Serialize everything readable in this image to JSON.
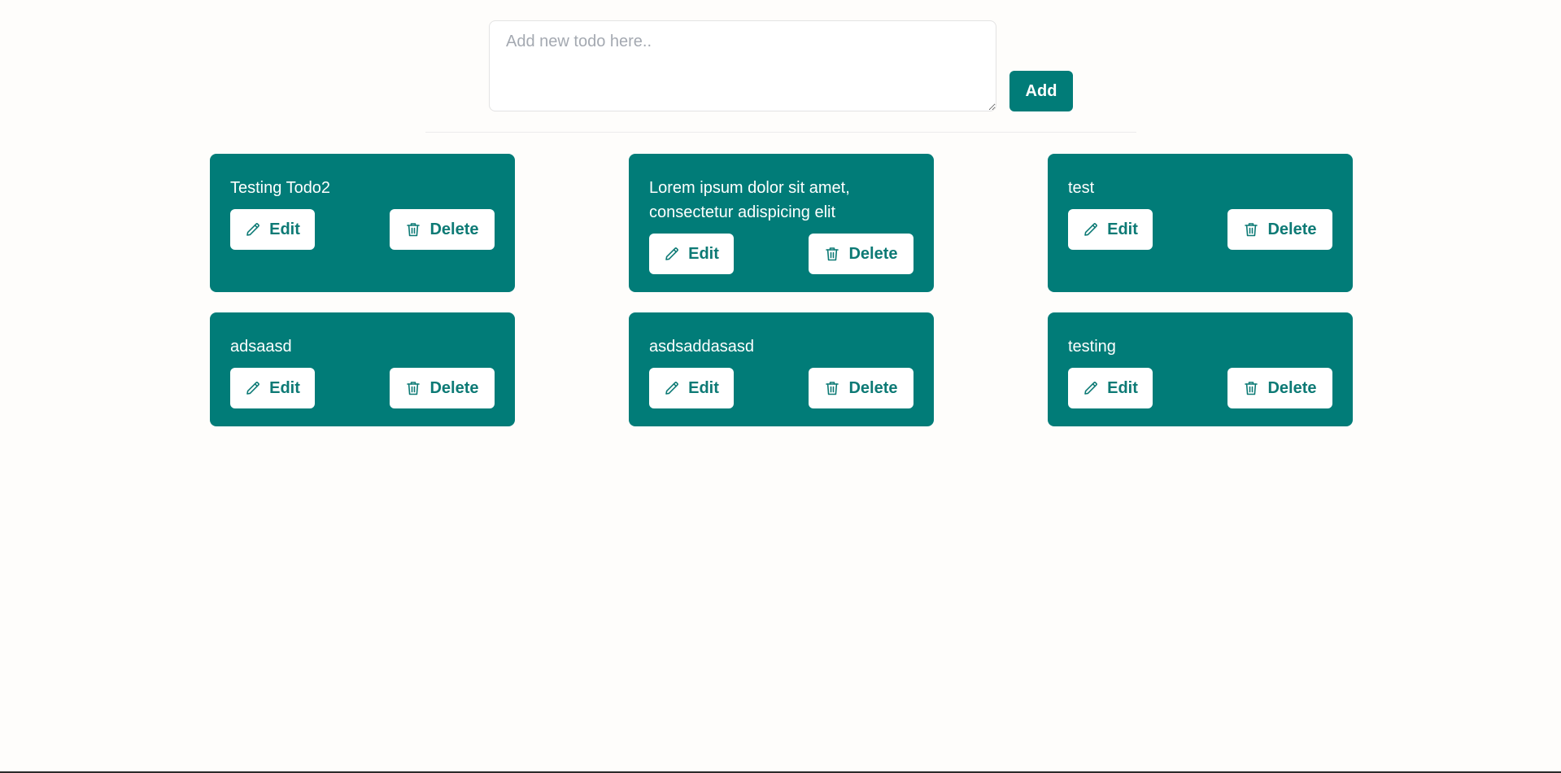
{
  "new_todo": {
    "placeholder": "Add new todo here..",
    "add_label": "Add"
  },
  "todos": [
    {
      "text": "Testing Todo2",
      "edit_label": "Edit",
      "delete_label": "Delete"
    },
    {
      "text": "Lorem ipsum dolor sit amet, consectetur adispicing elit",
      "edit_label": "Edit",
      "delete_label": "Delete"
    },
    {
      "text": "test",
      "edit_label": "Edit",
      "delete_label": "Delete"
    },
    {
      "text": "adsaasd",
      "edit_label": "Edit",
      "delete_label": "Delete"
    },
    {
      "text": "asdsaddasasd",
      "edit_label": "Edit",
      "delete_label": "Delete"
    },
    {
      "text": "testing",
      "edit_label": "Edit",
      "delete_label": "Delete"
    }
  ],
  "icons": {
    "edit": "pencil-icon",
    "delete": "trash-icon"
  },
  "colors": {
    "accent": "#017c78",
    "background": "#fefdfb",
    "button_text": "#0d7a75"
  }
}
